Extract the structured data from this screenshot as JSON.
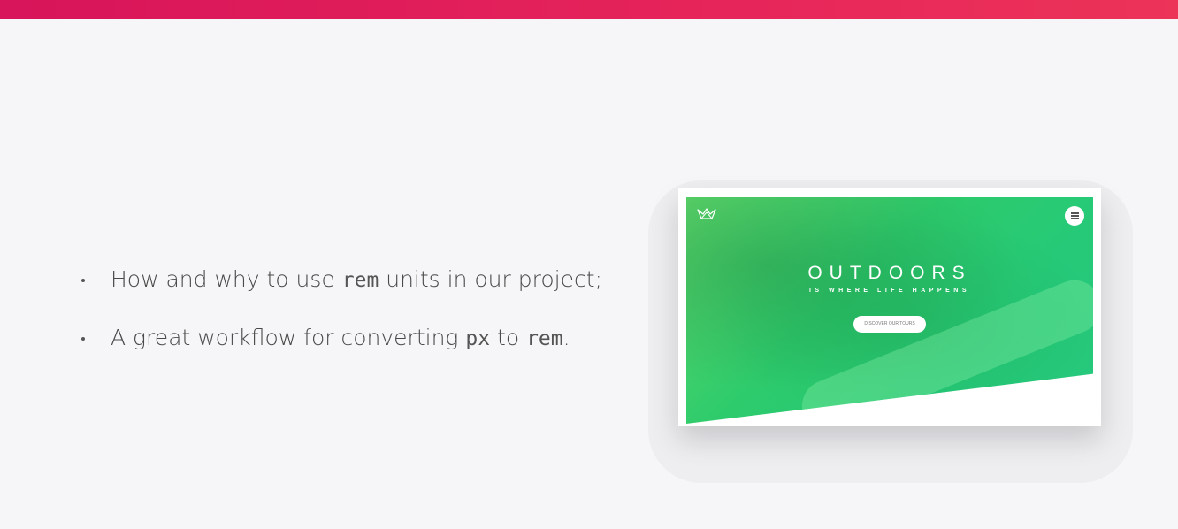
{
  "slide": {
    "accent_color": "#e11f5a",
    "bullets": [
      {
        "before": "How and why to use ",
        "code": "rem",
        "after": " units in our project;"
      },
      {
        "before": "A great workflow for converting ",
        "code": "px",
        "middle": " to ",
        "code2": "rem",
        "after": "."
      }
    ]
  },
  "mockup": {
    "logo_icon": "crown-icon",
    "menu_icon": "hamburger-menu-icon",
    "title": "OUTDOORS",
    "subtitle": "IS WHERE LIFE HAPPENS",
    "button_label": "DISCOVER OUR TOURS",
    "hero_color": "#2ecb6c"
  }
}
